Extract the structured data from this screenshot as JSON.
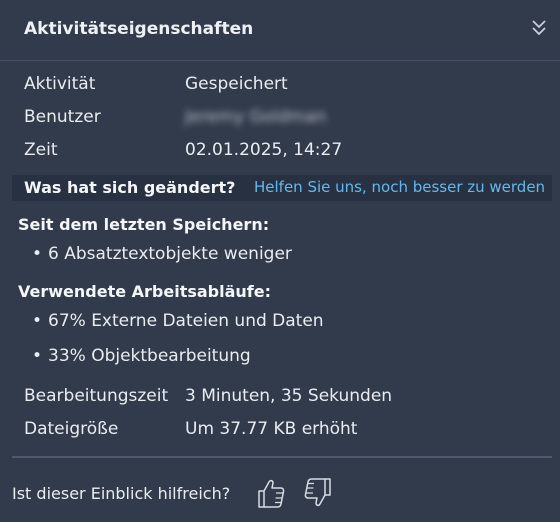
{
  "header": {
    "title": "Aktivitätseigenschaften",
    "collapse_icon": "double-chevron-down-icon"
  },
  "properties": [
    {
      "key": "Aktivität",
      "value": "Gespeichert"
    },
    {
      "key": "Benutzer",
      "value": "Jeremy Goldman"
    },
    {
      "key": "Zeit",
      "value": "02.01.2025, 14:27"
    }
  ],
  "changes": {
    "title": "Was hat sich geändert?",
    "help_link": "Helfen Sie uns, noch besser zu werden"
  },
  "since_last_save": {
    "title": "Seit dem letzten Speichern:",
    "items": [
      "6 Absatztextobjekte weniger"
    ]
  },
  "workflows": {
    "title": "Verwendete Arbeitsabläufe:",
    "items": [
      "67% Externe Dateien und Daten",
      "33% Objektbearbeitung"
    ]
  },
  "stats": [
    {
      "key": "Bearbeitungszeit",
      "value": "3 Minuten, 35 Sekunden"
    },
    {
      "key": "Dateigröße",
      "value": "Um 37.77 KB erhöht"
    }
  ],
  "feedback": {
    "question": "Ist dieser Einblick hilfreich?",
    "up_icon": "thumbs-up-icon",
    "down_icon": "thumbs-down-icon"
  },
  "colors": {
    "background": "#323b4b",
    "link": "#63b9ee",
    "bar": "#283141"
  }
}
